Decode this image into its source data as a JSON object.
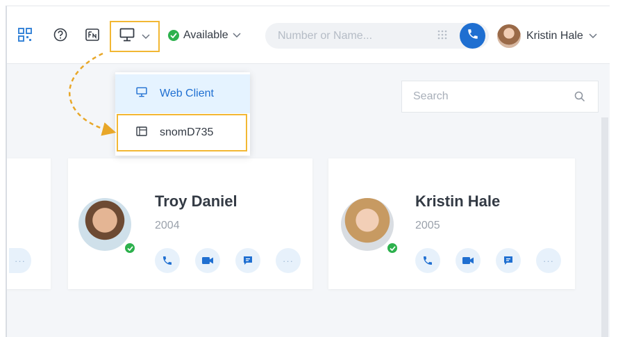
{
  "header": {
    "status_label": "Available",
    "search_placeholder": "Number or Name...",
    "user_name": "Kristin Hale"
  },
  "device_dropdown": {
    "items": [
      {
        "label": "Web Client",
        "selected": true
      },
      {
        "label": "snomD735",
        "highlighted": true
      }
    ]
  },
  "contacts_search": {
    "placeholder": "Search"
  },
  "contacts": [
    {
      "name": "Troy Daniel",
      "extension": "2004",
      "status": "online"
    },
    {
      "name": "Kristin Hale",
      "extension": "2005",
      "status": "online"
    }
  ],
  "colors": {
    "accent": "#1f6fd1",
    "highlight": "#f2b733",
    "online": "#2db14d"
  },
  "icons": {
    "qr": "qr-code-icon",
    "help": "help-icon",
    "fn": "fn-key-icon",
    "device": "monitor-icon",
    "call": "phone-icon",
    "video": "video-icon",
    "chat": "chat-icon",
    "more": "more-icon"
  }
}
